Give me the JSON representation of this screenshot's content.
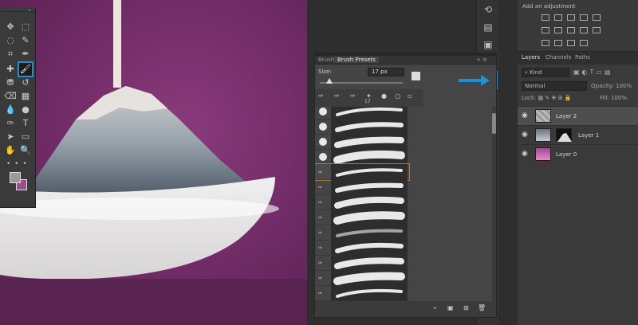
{
  "tools_panel": {
    "tools": [
      {
        "name": "move-icon",
        "glyph": "✥"
      },
      {
        "name": "marquee-icon",
        "glyph": "⬚"
      },
      {
        "name": "lasso-icon",
        "glyph": "◌"
      },
      {
        "name": "quick-select-icon",
        "glyph": "✎"
      },
      {
        "name": "crop-icon",
        "glyph": "⌗"
      },
      {
        "name": "eyedropper-icon",
        "glyph": "✒"
      },
      {
        "name": "healing-icon",
        "glyph": "✚"
      },
      {
        "name": "brush-icon",
        "glyph": "🖌"
      },
      {
        "name": "clone-stamp-icon",
        "glyph": "⛃"
      },
      {
        "name": "history-brush-icon",
        "glyph": "↺"
      },
      {
        "name": "eraser-icon",
        "glyph": "⌫"
      },
      {
        "name": "gradient-icon",
        "glyph": "▦"
      },
      {
        "name": "blur-icon",
        "glyph": "💧"
      },
      {
        "name": "dodge-icon",
        "glyph": "●"
      },
      {
        "name": "pen-icon",
        "glyph": "✑"
      },
      {
        "name": "type-icon",
        "glyph": "T"
      },
      {
        "name": "path-select-icon",
        "glyph": "➤"
      },
      {
        "name": "rectangle-icon",
        "glyph": "▭"
      },
      {
        "name": "hand-icon",
        "glyph": "✋"
      },
      {
        "name": "zoom-icon",
        "glyph": "🔍"
      }
    ],
    "more_label": "• • •"
  },
  "brush_panel": {
    "tabs": [
      "Brush",
      "Brush Presets"
    ],
    "size_label": "Size:",
    "size_value": "17 px",
    "quick_number": "17",
    "expand_arrows": "»",
    "menu_icon": "≡"
  },
  "adjustments": {
    "title": "Add an adjustment"
  },
  "layers_panel": {
    "tabs": [
      "Layers",
      "Channels",
      "Paths"
    ],
    "kind_label": "Kind",
    "blend_mode": "Normal",
    "opacity_label": "Opacity:",
    "opacity_value": "100%",
    "lock_label": "Lock:",
    "fill_label": "Fill:",
    "fill_value": "100%",
    "layers": [
      {
        "name": "Layer 2",
        "selected": true
      },
      {
        "name": "Layer 1",
        "selected": false
      },
      {
        "name": "Layer 0",
        "selected": false
      }
    ]
  },
  "colors": {
    "accent": "#1e90d6",
    "canvas_bg": "#6d2a63",
    "panel_bg": "#454545"
  }
}
